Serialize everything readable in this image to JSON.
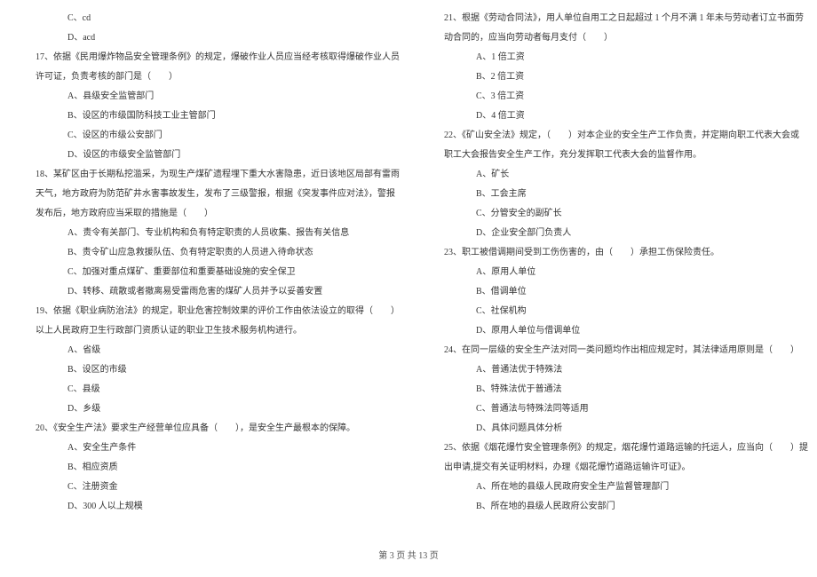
{
  "left": {
    "l1": "C、cd",
    "l2": "D、acd",
    "l3": "17、依据《民用爆炸物品安全管理条例》的规定，爆破作业人员应当经考核取得爆破作业人员",
    "l4": "许可证，负责考核的部门是（　　）",
    "l5": "A、县级安全监管部门",
    "l6": "B、设区的市级国防科技工业主管部门",
    "l7": "C、设区的市级公安部门",
    "l8": "D、设区的市级安全监管部门",
    "l9": "18、某矿区由于长期私挖滥采，为现生产煤矿遗程埋下重大水害隐患，近日该地区局部有雷雨",
    "l10": "天气，地方政府为防范矿井水害事故发生，发布了三级警报，根据《突发事件应对法》，警报",
    "l11": "发布后，地方政府应当采取的措施是（　　）",
    "l12": "A、责令有关部门、专业机构和负有特定职责的人员收集、报告有关信息",
    "l13": "B、责令矿山应急救援队伍、负有特定职责的人员进入待命状态",
    "l14": "C、加强对重点煤矿、重要部位和重要基础设施的安全保卫",
    "l15": "D、转移、疏散或者撤离易受雷雨危害的煤矿人员并予以妥善安置",
    "l16": "19、依据《职业病防治法》的规定，职业危害控制效果的评价工作由依法设立的取得（　　）",
    "l17": "以上人民政府卫生行政部门资质认证的职业卫生技术服务机构进行。",
    "l18": "A、省级",
    "l19": "B、设区的市级",
    "l20": "C、县级",
    "l21": "D、乡级",
    "l22": "20、《安全生产法》要求生产经营单位应具备（　　），是安全生产最根本的保障。",
    "l23": "A、安全生产条件",
    "l24": "B、相应资质",
    "l25": "C、注册资金",
    "l26": "D、300 人以上规模"
  },
  "right": {
    "r1": "21、根据《劳动合同法》，用人单位自用工之日起超过 1 个月不满 1 年未与劳动者订立书面劳",
    "r2": "动合同的，应当向劳动者每月支付（　　）",
    "r3": "A、1 倍工资",
    "r4": "B、2 倍工资",
    "r5": "C、3 倍工资",
    "r6": "D、4 倍工资",
    "r7": "22、《矿山安全法》规定，（　　）对本企业的安全生产工作负责，并定期向职工代表大会或",
    "r8": "职工大会报告安全生产工作，充分发挥职工代表大会的监督作用。",
    "r9": "A、矿长",
    "r10": "B、工会主席",
    "r11": "C、分管安全的副矿长",
    "r12": "D、企业安全部门负责人",
    "r13": "23、职工被借调期间受到工伤伤害的，由（　　）承担工伤保险责任。",
    "r14": "A、原用人单位",
    "r15": "B、借调单位",
    "r16": "C、社保机构",
    "r17": "D、原用人单位与借调单位",
    "r18": "24、在同一层级的安全生产法对同一类问题均作出相应规定时，其法律适用原则是（　　）",
    "r19": "A、普通法优于特殊法",
    "r20": "B、特殊法优于普通法",
    "r21": "C、普通法与特殊法同等适用",
    "r22": "D、具体问题具体分析",
    "r23": "25、依据《烟花爆竹安全管理条例》的规定，烟花爆竹道路运输的托运人，应当向（　　）提",
    "r24": "出申请,提交有关证明材料，办理《烟花爆竹道路运输许可证》。",
    "r25": "A、所在地的县级人民政府安全生产监督管理部门",
    "r26": "B、所在地的县级人民政府公安部门"
  },
  "footer": "第 3 页 共 13 页"
}
